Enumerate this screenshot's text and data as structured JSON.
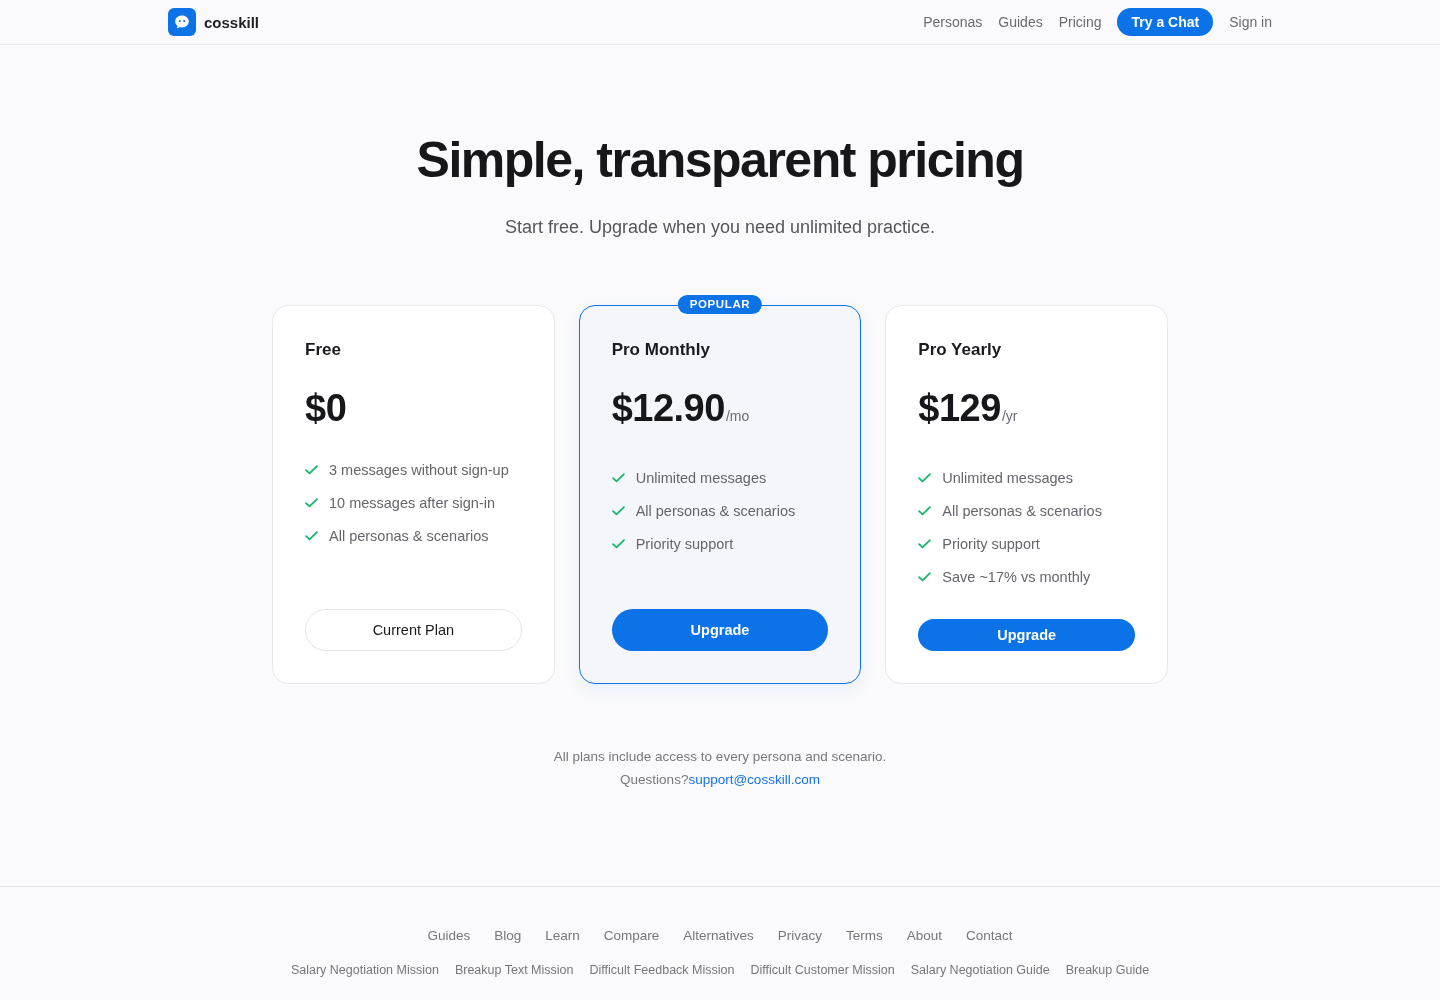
{
  "header": {
    "brand": "cosskill",
    "nav": [
      {
        "label": "Personas",
        "kind": "link"
      },
      {
        "label": "Guides",
        "kind": "link"
      },
      {
        "label": "Pricing",
        "kind": "link"
      },
      {
        "label": "Try a Chat",
        "kind": "button"
      },
      {
        "label": "Sign in",
        "kind": "link"
      }
    ]
  },
  "hero": {
    "title": "Simple, transparent pricing",
    "subtitle": "Start free. Upgrade when you need unlimited practice."
  },
  "plans": [
    {
      "name": "Free",
      "price": "$0",
      "highlighted": false,
      "features": [
        "3 messages without sign-up",
        "10 messages after sign-in",
        "All personas & scenarios"
      ],
      "button": {
        "label": "Current Plan",
        "kind": "outline"
      }
    },
    {
      "name": "Pro Monthly",
      "price": "$12.90",
      "period": "/mo",
      "badge": "POPULAR",
      "highlighted": true,
      "features": [
        "Unlimited messages",
        "All personas & scenarios",
        "Priority support"
      ],
      "button": {
        "label": "Upgrade",
        "kind": "primary"
      }
    },
    {
      "name": "Pro Yearly",
      "price": "$129",
      "period": "/yr",
      "highlighted": false,
      "features": [
        "Unlimited messages",
        "All personas & scenarios",
        "Priority support",
        "Save ~17% vs monthly"
      ],
      "button": {
        "label": "Upgrade",
        "kind": "primary"
      }
    }
  ],
  "note": {
    "text": "All plans include access to every persona and scenario.",
    "question": "Questions?",
    "email": "support@cosskill.com"
  },
  "footer": {
    "links": [
      "Guides",
      "Blog",
      "Learn",
      "Compare",
      "Alternatives",
      "Privacy",
      "Terms",
      "About",
      "Contact"
    ],
    "guide_links": [
      "Salary Negotiation Mission",
      "Breakup Text Mission",
      "Difficult Feedback Mission",
      "Difficult Customer Mission",
      "Salary Negotiation Guide",
      "Breakup Guide"
    ]
  }
}
